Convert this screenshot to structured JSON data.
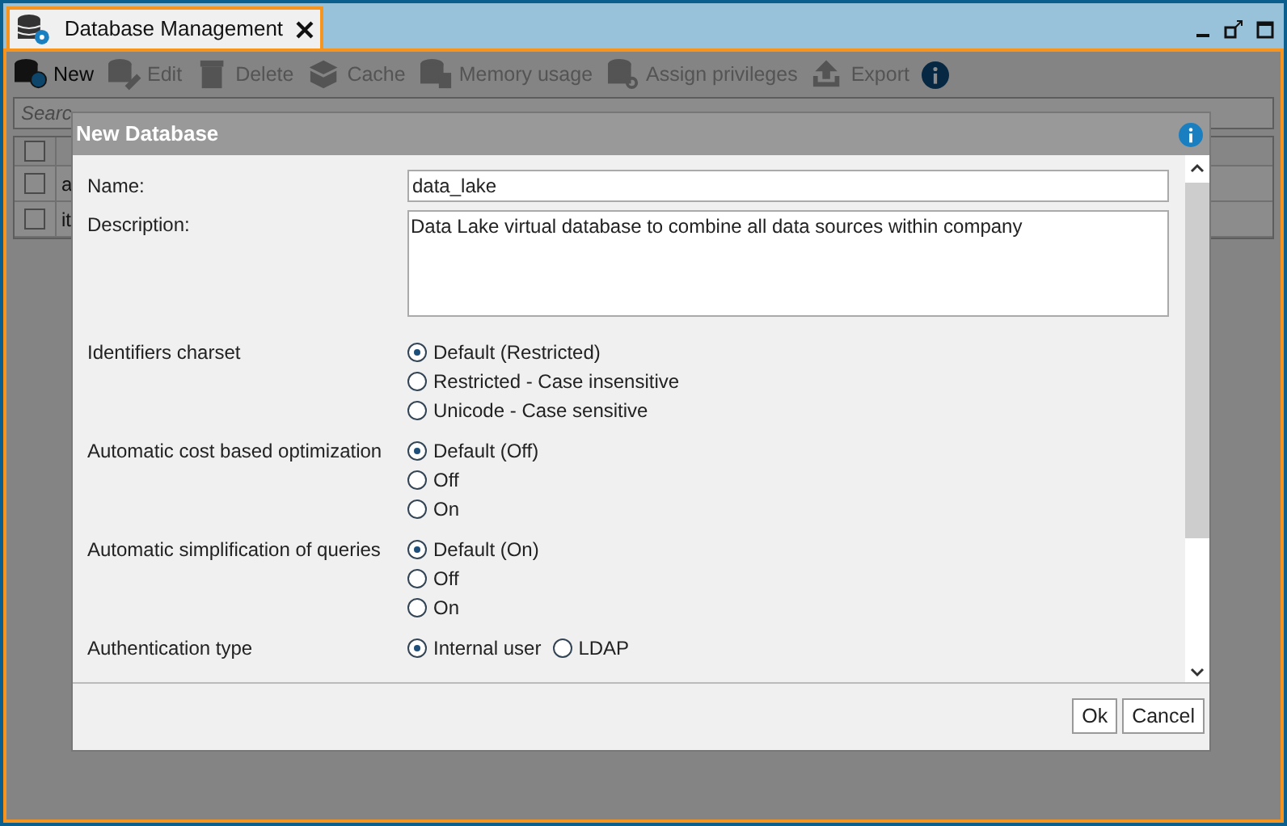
{
  "tab": {
    "title": "Database Management"
  },
  "toolbar": [
    {
      "label": "New",
      "disabled": false
    },
    {
      "label": "Edit",
      "disabled": true
    },
    {
      "label": "Delete",
      "disabled": true
    },
    {
      "label": "Cache",
      "disabled": true
    },
    {
      "label": "Memory usage",
      "disabled": true
    },
    {
      "label": "Assign privileges",
      "disabled": true
    },
    {
      "label": "Export",
      "disabled": true
    }
  ],
  "search": {
    "placeholder": "Searc"
  },
  "table": {
    "header_checked": false,
    "rows": [
      {
        "checked": false,
        "column_2": "a"
      },
      {
        "checked": false,
        "column_2": "it"
      }
    ]
  },
  "dialog": {
    "title": "New Database",
    "name": {
      "label": "Name:",
      "value": "data_lake"
    },
    "description": {
      "label": "Description:",
      "value": "Data Lake virtual database to combine all data sources within company"
    },
    "groups": [
      {
        "label": "Identifiers charset",
        "kind": "stacked",
        "options": [
          {
            "label": "Default (Restricted)",
            "selected": true
          },
          {
            "label": "Restricted - Case insensitive",
            "selected": false
          },
          {
            "label": "Unicode - Case sensitive",
            "selected": false
          }
        ]
      },
      {
        "label": "Automatic cost based optimization",
        "kind": "stacked",
        "options": [
          {
            "label": "Default (Off)",
            "selected": true
          },
          {
            "label": "Off",
            "selected": false
          },
          {
            "label": "On",
            "selected": false
          }
        ]
      },
      {
        "label": "Automatic simplification of queries",
        "kind": "stacked",
        "options": [
          {
            "label": "Default (On)",
            "selected": true
          },
          {
            "label": "Off",
            "selected": false
          },
          {
            "label": "On",
            "selected": false
          }
        ]
      },
      {
        "label": "Authentication type",
        "kind": "inline",
        "options": [
          {
            "label": "Internal user",
            "selected": true
          },
          {
            "label": "LDAP",
            "selected": false
          }
        ]
      }
    ],
    "buttons": [
      "Ok",
      "Cancel"
    ]
  }
}
